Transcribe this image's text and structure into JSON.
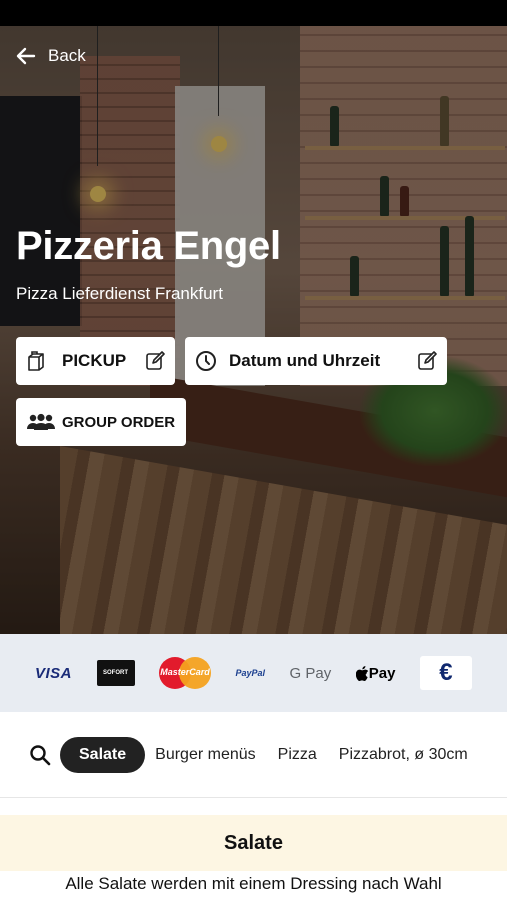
{
  "header": {
    "back_label": "Back",
    "title": "Pizzeria Engel",
    "subtitle": "Pizza Lieferdienst Frankfurt"
  },
  "order_options": {
    "pickup_label": "PICKUP",
    "datetime_label": "Datum und Uhrzeit",
    "group_order_label": "GROUP ORDER"
  },
  "payments": {
    "visa": "VISA",
    "sofort": "SOFORT",
    "mastercard": "MasterCard",
    "paypal": "PayPal",
    "gpay": "G Pay",
    "applepay": "Pay",
    "euro": "€"
  },
  "categories": {
    "active": "Salate",
    "items": [
      "Burger menüs",
      "Pizza",
      "Pizzabrot, ø 30cm"
    ]
  },
  "section": {
    "title": "Salate",
    "description": "Alle Salate werden mit einem Dressing nach Wahl"
  },
  "colors": {
    "payment_bar": "#e8ecf2",
    "section_header_bg": "#fdf6e3",
    "active_chip": "#222222"
  },
  "icons": {
    "back": "arrow-left-icon",
    "pickup": "bag-icon",
    "edit": "edit-icon",
    "clock": "clock-icon",
    "group": "group-icon",
    "search": "search-icon"
  }
}
